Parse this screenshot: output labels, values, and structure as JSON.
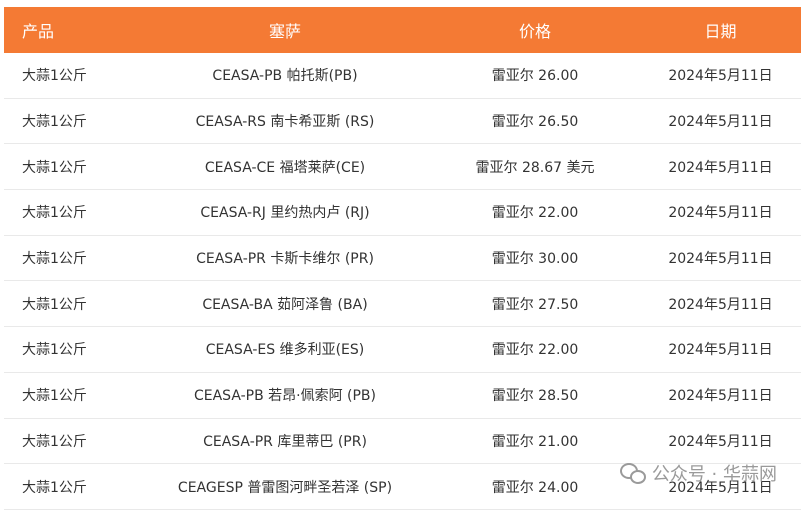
{
  "headers": [
    "产品",
    "塞萨",
    "价格",
    "日期"
  ],
  "rows": [
    {
      "product": "大蒜1公斤",
      "ceasa": "CEASA-PB 帕托斯(PB)",
      "price": "雷亚尔 26.00",
      "date": "2024年5月11日"
    },
    {
      "product": "大蒜1公斤",
      "ceasa": "CEASA-RS 南卡希亚斯 (RS)",
      "price": "雷亚尔 26.50",
      "date": "2024年5月11日"
    },
    {
      "product": "大蒜1公斤",
      "ceasa": "CEASA-CE 福塔莱萨(CE)",
      "price": "雷亚尔 28.67 美元",
      "date": "2024年5月11日"
    },
    {
      "product": "大蒜1公斤",
      "ceasa": "CEASA-RJ 里约热内卢 (RJ)",
      "price": "雷亚尔 22.00",
      "date": "2024年5月11日"
    },
    {
      "product": "大蒜1公斤",
      "ceasa": "CEASA-PR 卡斯卡维尔 (PR)",
      "price": "雷亚尔 30.00",
      "date": "2024年5月11日"
    },
    {
      "product": "大蒜1公斤",
      "ceasa": "CEASA-BA 茹阿泽鲁 (BA)",
      "price": "雷亚尔 27.50",
      "date": "2024年5月11日"
    },
    {
      "product": "大蒜1公斤",
      "ceasa": "CEASA-ES 维多利亚(ES)",
      "price": "雷亚尔 22.00",
      "date": "2024年5月11日"
    },
    {
      "product": "大蒜1公斤",
      "ceasa": "CEASA-PB 若昂·佩索阿 (PB)",
      "price": "雷亚尔 28.50",
      "date": "2024年5月11日"
    },
    {
      "product": "大蒜1公斤",
      "ceasa": "CEASA-PR 库里蒂巴 (PR)",
      "price": "雷亚尔 21.00",
      "date": "2024年5月11日"
    },
    {
      "product": "大蒜1公斤",
      "ceasa": "CEAGESP 普雷图河畔圣若泽 (SP)",
      "price": "雷亚尔 24.00",
      "date": "2024年5月11日"
    }
  ],
  "watermark": {
    "text": "公众号 · 华蒜网",
    "icon": "wechat-icon"
  }
}
